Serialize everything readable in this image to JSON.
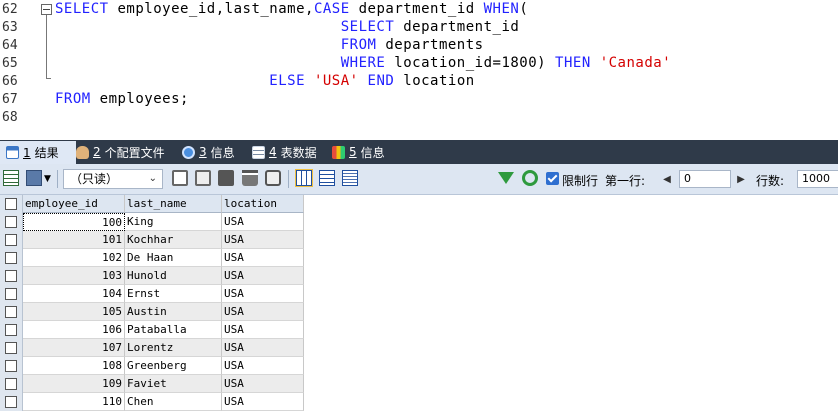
{
  "editor": {
    "lines": [
      {
        "num": "62",
        "segments": [
          {
            "t": "SELECT",
            "k": "kw"
          },
          {
            "t": " employee_id,last_name,",
            "k": ""
          },
          {
            "t": "CASE",
            "k": "kw"
          },
          {
            "t": " department_id ",
            "k": ""
          },
          {
            "t": "WHEN",
            "k": "kw"
          },
          {
            "t": "(",
            "k": ""
          }
        ]
      },
      {
        "num": "63",
        "segments": [
          {
            "t": "                                ",
            "k": ""
          },
          {
            "t": "SELECT",
            "k": "kw"
          },
          {
            "t": " department_id",
            "k": ""
          }
        ]
      },
      {
        "num": "64",
        "segments": [
          {
            "t": "                                ",
            "k": ""
          },
          {
            "t": "FROM",
            "k": "kw"
          },
          {
            "t": " departments",
            "k": ""
          }
        ]
      },
      {
        "num": "65",
        "segments": [
          {
            "t": "                                ",
            "k": ""
          },
          {
            "t": "WHERE",
            "k": "kw"
          },
          {
            "t": " location_id=1800) ",
            "k": ""
          },
          {
            "t": "THEN",
            "k": "kw"
          },
          {
            "t": " ",
            "k": ""
          },
          {
            "t": "'Canada'",
            "k": "str"
          }
        ]
      },
      {
        "num": "66",
        "segments": [
          {
            "t": "                        ",
            "k": ""
          },
          {
            "t": "ELSE",
            "k": "kw"
          },
          {
            "t": " ",
            "k": ""
          },
          {
            "t": "'USA'",
            "k": "str"
          },
          {
            "t": " ",
            "k": ""
          },
          {
            "t": "END",
            "k": "kw"
          },
          {
            "t": " location",
            "k": ""
          }
        ]
      },
      {
        "num": "67",
        "segments": [
          {
            "t": "FROM",
            "k": "kw"
          },
          {
            "t": " employees;",
            "k": ""
          }
        ]
      },
      {
        "num": "68",
        "segments": []
      }
    ]
  },
  "tabs": [
    {
      "num": "1",
      "label": "结果",
      "icon": "table-grid-icon",
      "active": true
    },
    {
      "num": "2",
      "label": "个配置文件",
      "icon": "profile-hand-icon",
      "active": false
    },
    {
      "num": "3",
      "label": "信息",
      "icon": "info-icon",
      "active": false
    },
    {
      "num": "4",
      "label": "表数据",
      "icon": "table-data-icon",
      "active": false
    },
    {
      "num": "5",
      "label": "信息",
      "icon": "info-blocks-icon",
      "active": false
    }
  ],
  "toolbar": {
    "mode": "（只读）",
    "limit_label": "限制行",
    "first_row_label": "第一行:",
    "first_row_value": "0",
    "rows_label": "行数:",
    "rows_value": "1000"
  },
  "grid": {
    "columns": [
      "employee_id",
      "last_name",
      "location"
    ],
    "rows": [
      [
        "100",
        "King",
        "USA"
      ],
      [
        "101",
        "Kochhar",
        "USA"
      ],
      [
        "102",
        "De Haan",
        "USA"
      ],
      [
        "103",
        "Hunold",
        "USA"
      ],
      [
        "104",
        "Ernst",
        "USA"
      ],
      [
        "105",
        "Austin",
        "USA"
      ],
      [
        "106",
        "Pataballa",
        "USA"
      ],
      [
        "107",
        "Lorentz",
        "USA"
      ],
      [
        "108",
        "Greenberg",
        "USA"
      ],
      [
        "109",
        "Faviet",
        "USA"
      ],
      [
        "110",
        "Chen",
        "USA"
      ]
    ]
  },
  "colors": {
    "keyword": "#2222ff",
    "string": "#d40000",
    "tab_bar": "#2f3a49",
    "toolbar": "#dde6f2"
  }
}
